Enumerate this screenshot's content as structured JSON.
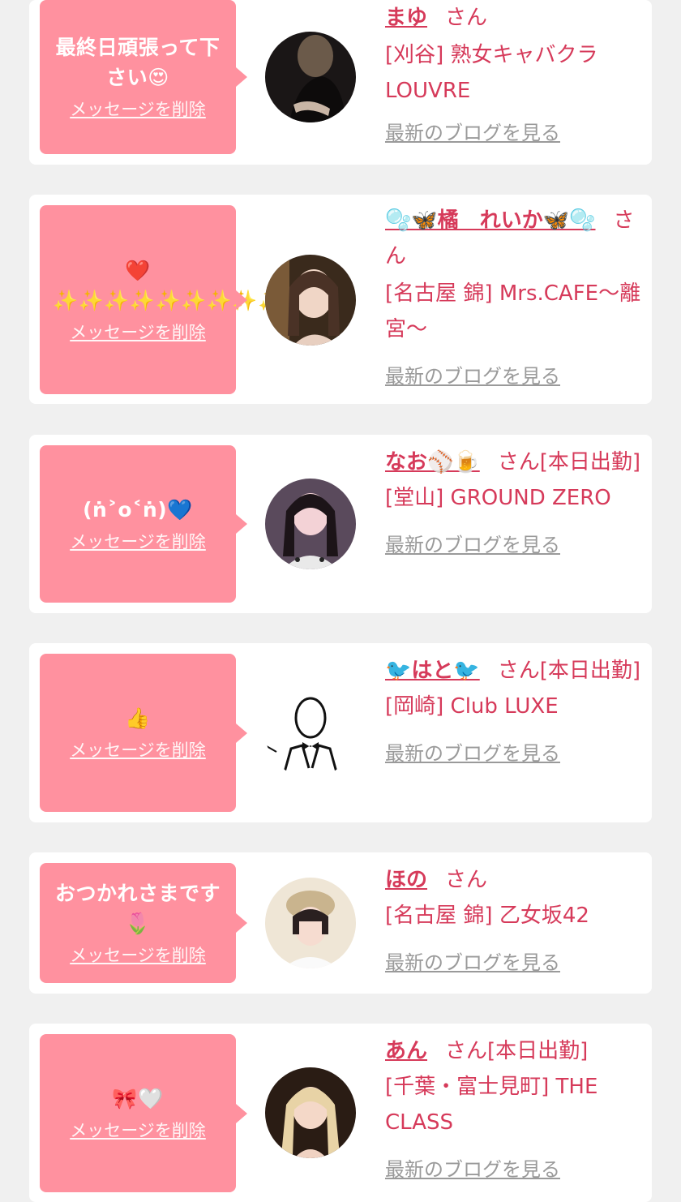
{
  "delete_label": "メッセージを削除",
  "blog_label": "最新のブログを見る",
  "entries": [
    {
      "message": "最終日頑張って下さい😍",
      "name": "まゆ",
      "suffix": "さん",
      "shop": "[刈谷] 熟女キャバクラLOUVRE"
    },
    {
      "message": "❤️✨✨✨✨✨✨✨✨✨✨",
      "name": "🫧🦋橘　れいか🦋🫧",
      "suffix": "さん",
      "shop": "[名古屋 錦] Mrs.CAFE〜離宮〜"
    },
    {
      "message": "(ṅ˃o˂ṅ)💙",
      "name": "なお⚾️🍺",
      "suffix": "さん[本日出勤]",
      "shop": "[堂山] GROUND ZERO"
    },
    {
      "message": "👍",
      "name": "🐦はと🐦",
      "suffix": "さん[本日出勤]",
      "shop": "[岡崎] Club LUXE"
    },
    {
      "message": "おつかれさまです🌷",
      "name": "ほの",
      "suffix": "さん",
      "shop": "[名古屋 錦] 乙女坂42"
    },
    {
      "message": "🎀🤍",
      "name": "あん",
      "suffix": "さん[本日出勤]",
      "shop": "[千葉・富士見町] THE CLASS"
    }
  ]
}
